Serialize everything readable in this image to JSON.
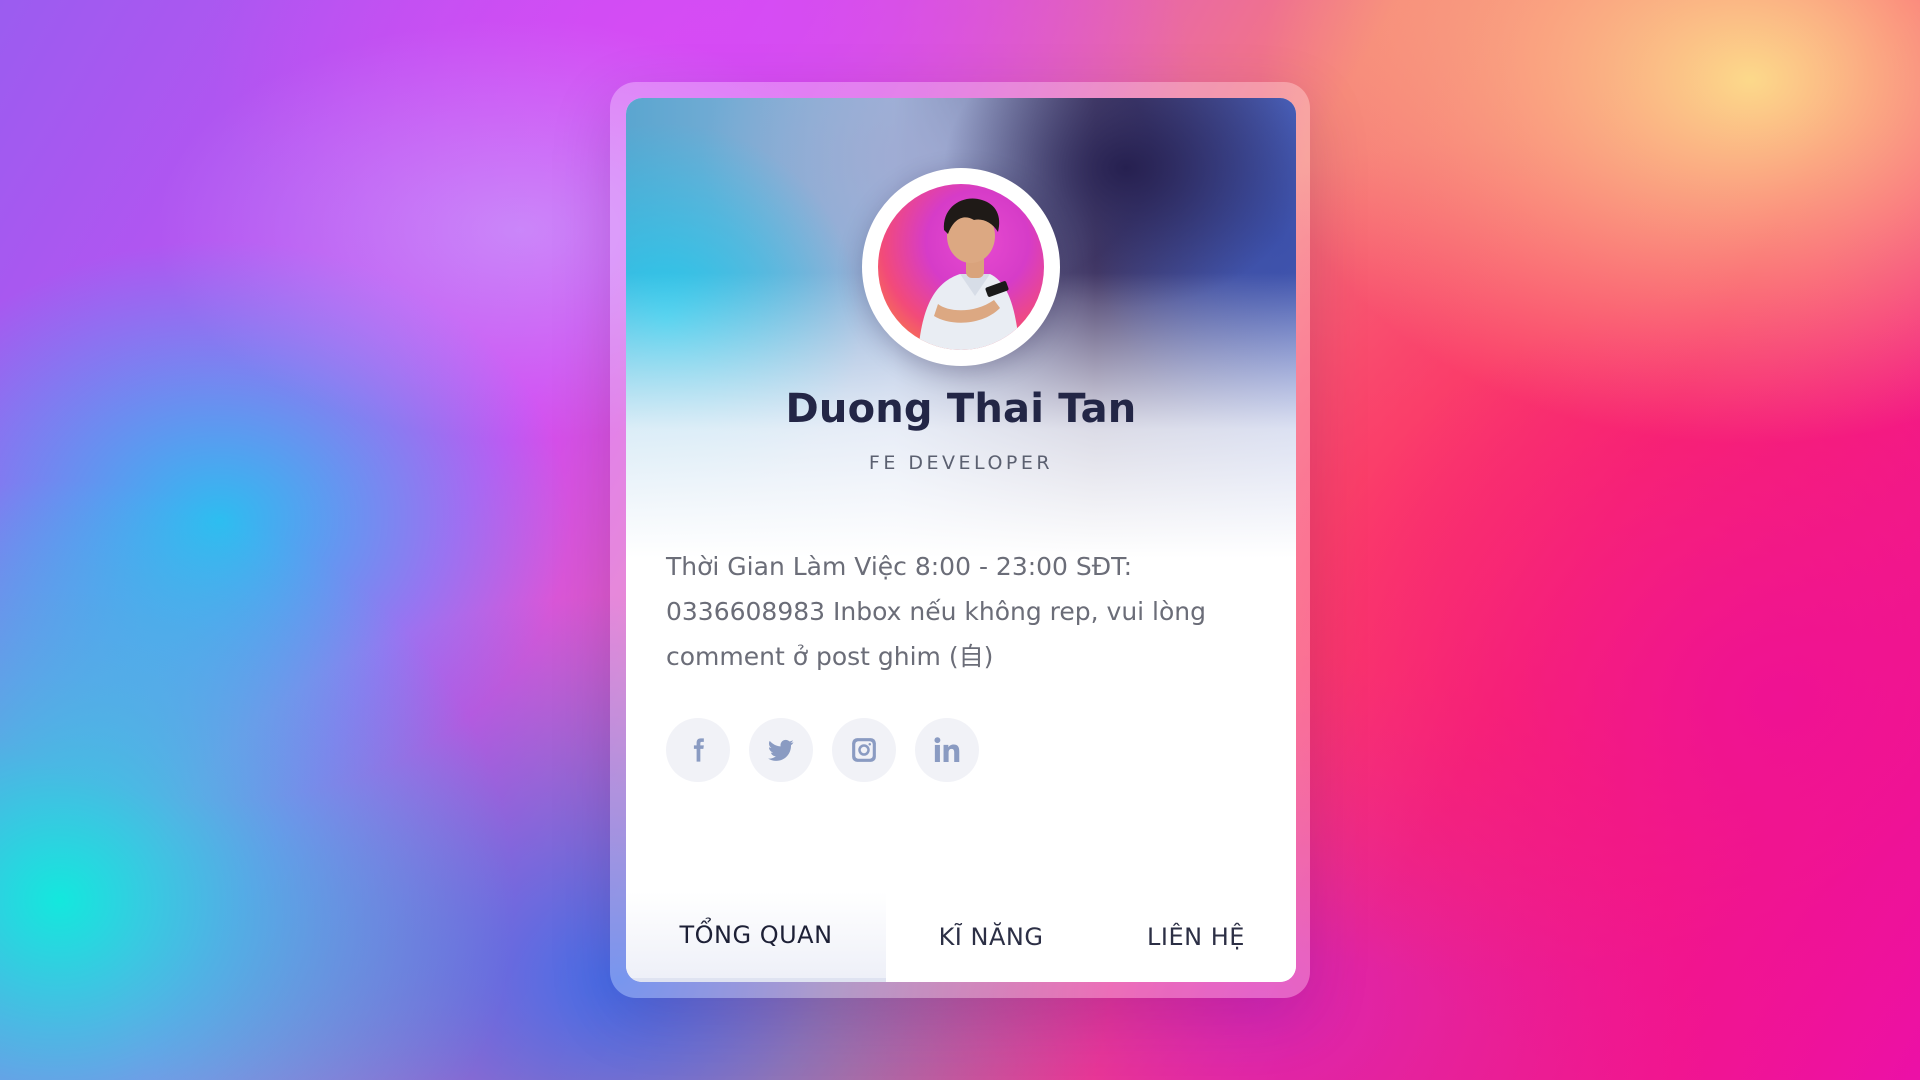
{
  "profile": {
    "name": "Duong Thai Tan",
    "role": "FE DEVELOPER",
    "bio": "Thời Gian Làm Việc 8:00 - 23:00 SĐT: 0336608983 Inbox nếu không rep, vui lòng comment ở post ghim (自)"
  },
  "socials": [
    {
      "icon": "facebook-icon"
    },
    {
      "icon": "twitter-icon"
    },
    {
      "icon": "instagram-icon"
    },
    {
      "icon": "linkedin-icon"
    }
  ],
  "tabs": [
    {
      "label": "TỔNG QUAN",
      "active": true
    },
    {
      "label": "KĨ NĂNG",
      "active": false
    },
    {
      "label": "LIÊN HỆ",
      "active": false
    }
  ],
  "colors": {
    "name": "#232646",
    "text": "#6b6d78",
    "icon": "#8a9bc2",
    "icon_bg": "#f1f2f7"
  }
}
